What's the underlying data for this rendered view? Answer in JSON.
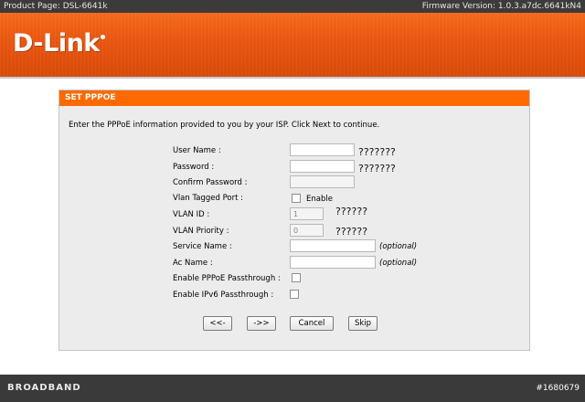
{
  "header": {
    "product_page": "Product Page: DSL-6641k",
    "firmware_version": "Firmware Version: 1.0.3.a7dc.6641kN4",
    "logo": "D-Link"
  },
  "panel": {
    "title": "SET PPPOE",
    "instructions": "Enter the PPPoE information provided to you by your ISP. Click Next to continue.",
    "fields": {
      "user_name": {
        "label": "User Name :",
        "value": "",
        "hint": "???????"
      },
      "password": {
        "label": "Password :",
        "value": "",
        "hint": "???????"
      },
      "confirm_password": {
        "label": "Confirm Password :",
        "value": ""
      },
      "vlan_tagged_port": {
        "label": "Vlan Tagged Port :",
        "checkbox_label": "Enable",
        "checked": false
      },
      "vlan_id": {
        "label": "VLAN ID :",
        "value": "1",
        "hint": "??????"
      },
      "vlan_priority": {
        "label": "VLAN Priority :",
        "value": "0",
        "hint": "??????"
      },
      "service_name": {
        "label": "Service Name :",
        "value": "",
        "note": "(optional)"
      },
      "ac_name": {
        "label": "Ac Name :",
        "value": "",
        "note": "(optional)"
      },
      "pppoe_passthrough": {
        "label": "Enable PPPoE Passthrough :",
        "checked": false
      },
      "ipv6_passthrough": {
        "label": "Enable IPv6 Passthrough :",
        "checked": false
      }
    },
    "buttons": {
      "back": "<<-",
      "next": "->>",
      "cancel": "Cancel",
      "skip": "Skip"
    }
  },
  "footer": {
    "brand": "BROADBAND",
    "watermark": "#1680679"
  },
  "colors": {
    "brand_orange": "#ff6a00",
    "topbar": "#3b3b3b",
    "panel_bg": "#ececec"
  }
}
